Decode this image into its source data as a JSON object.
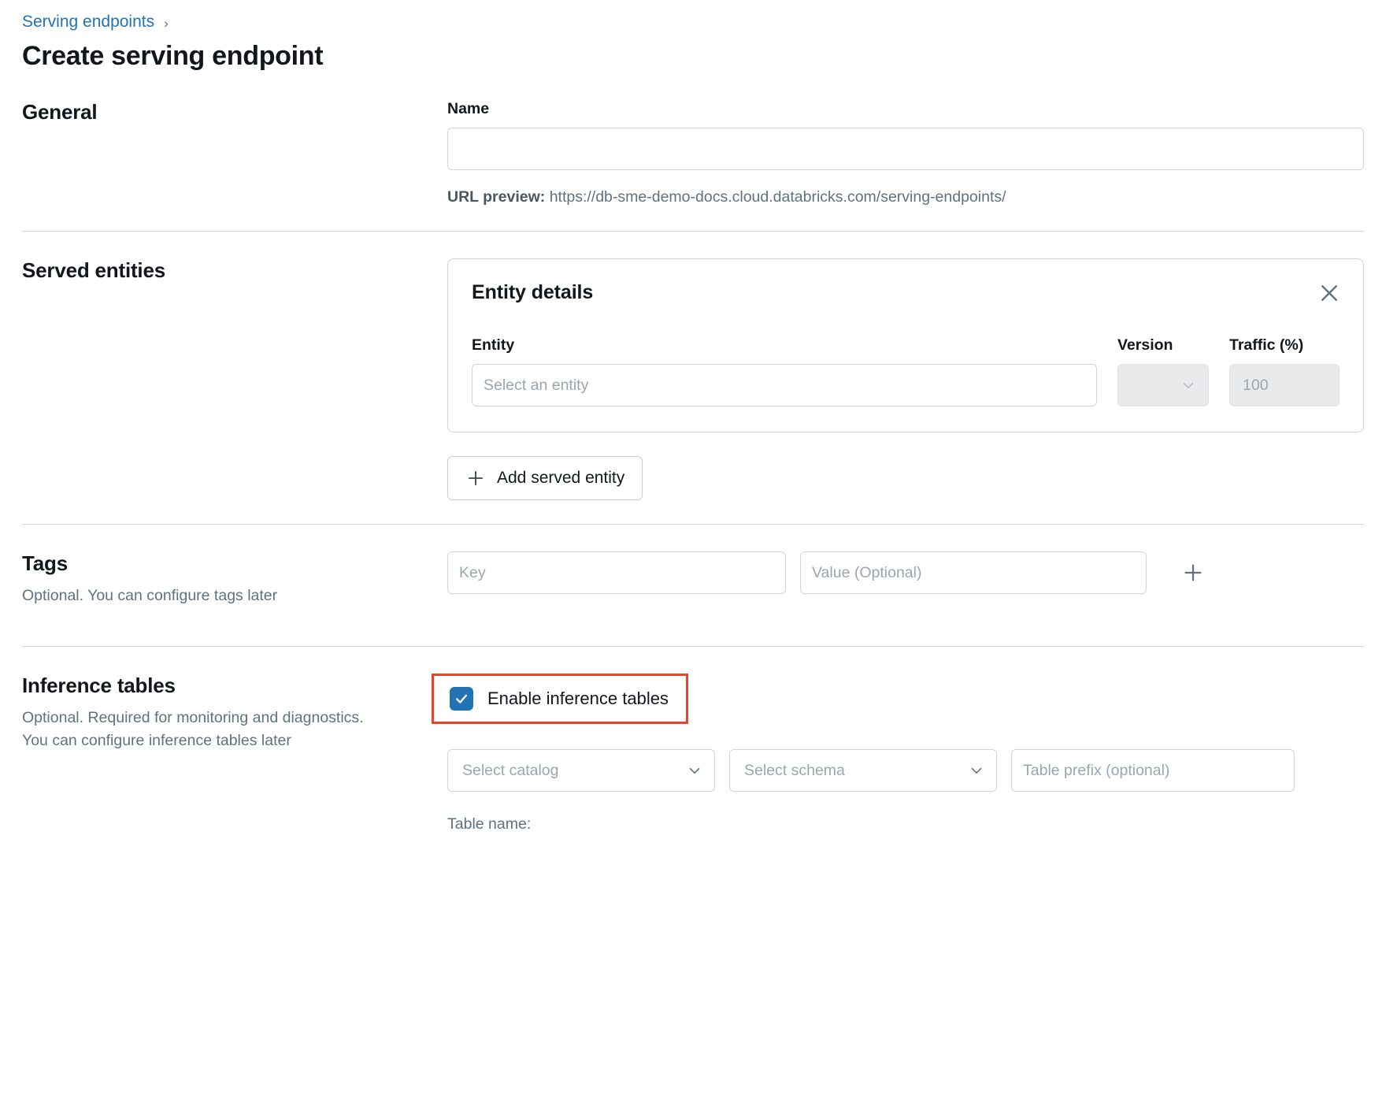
{
  "breadcrumb": {
    "link": "Serving endpoints",
    "separator": "›"
  },
  "page_title": "Create serving endpoint",
  "general": {
    "section_title": "General",
    "name_label": "Name",
    "name_value": "",
    "name_placeholder": "",
    "url_preview_label": "URL preview:",
    "url_preview_value": "https://db-sme-demo-docs.cloud.databricks.com/serving-endpoints/"
  },
  "served_entities": {
    "section_title": "Served entities",
    "card": {
      "title": "Entity details",
      "close_icon": "close-icon",
      "columns": {
        "entity": "Entity",
        "version": "Version",
        "traffic": "Traffic (%)"
      },
      "entity_placeholder": "Select an entity",
      "entity_value": "",
      "version_value": "",
      "traffic_value": "100"
    },
    "add_button": {
      "icon": "plus-icon",
      "label": "Add served entity"
    }
  },
  "tags": {
    "section_title": "Tags",
    "section_sub": "Optional. You can configure tags later",
    "key_placeholder": "Key",
    "key_value": "",
    "value_placeholder": "Value (Optional)",
    "value_value": "",
    "add_icon": "plus-icon"
  },
  "inference_tables": {
    "section_title": "Inference tables",
    "section_sub": "Optional. Required for monitoring and diagnostics. You can configure inference tables later",
    "enable_label": "Enable inference tables",
    "enable_checked": true,
    "catalog_placeholder": "Select catalog",
    "schema_placeholder": "Select schema",
    "table_prefix_placeholder": "Table prefix (optional)",
    "table_prefix_value": "",
    "table_name_label": "Table name:",
    "table_name_value": ""
  },
  "colors": {
    "link": "#2272B4",
    "highlight": "#E8442A",
    "checkbox": "#2272B4",
    "muted_text": "#5F7281",
    "border": "#d0d5da"
  }
}
